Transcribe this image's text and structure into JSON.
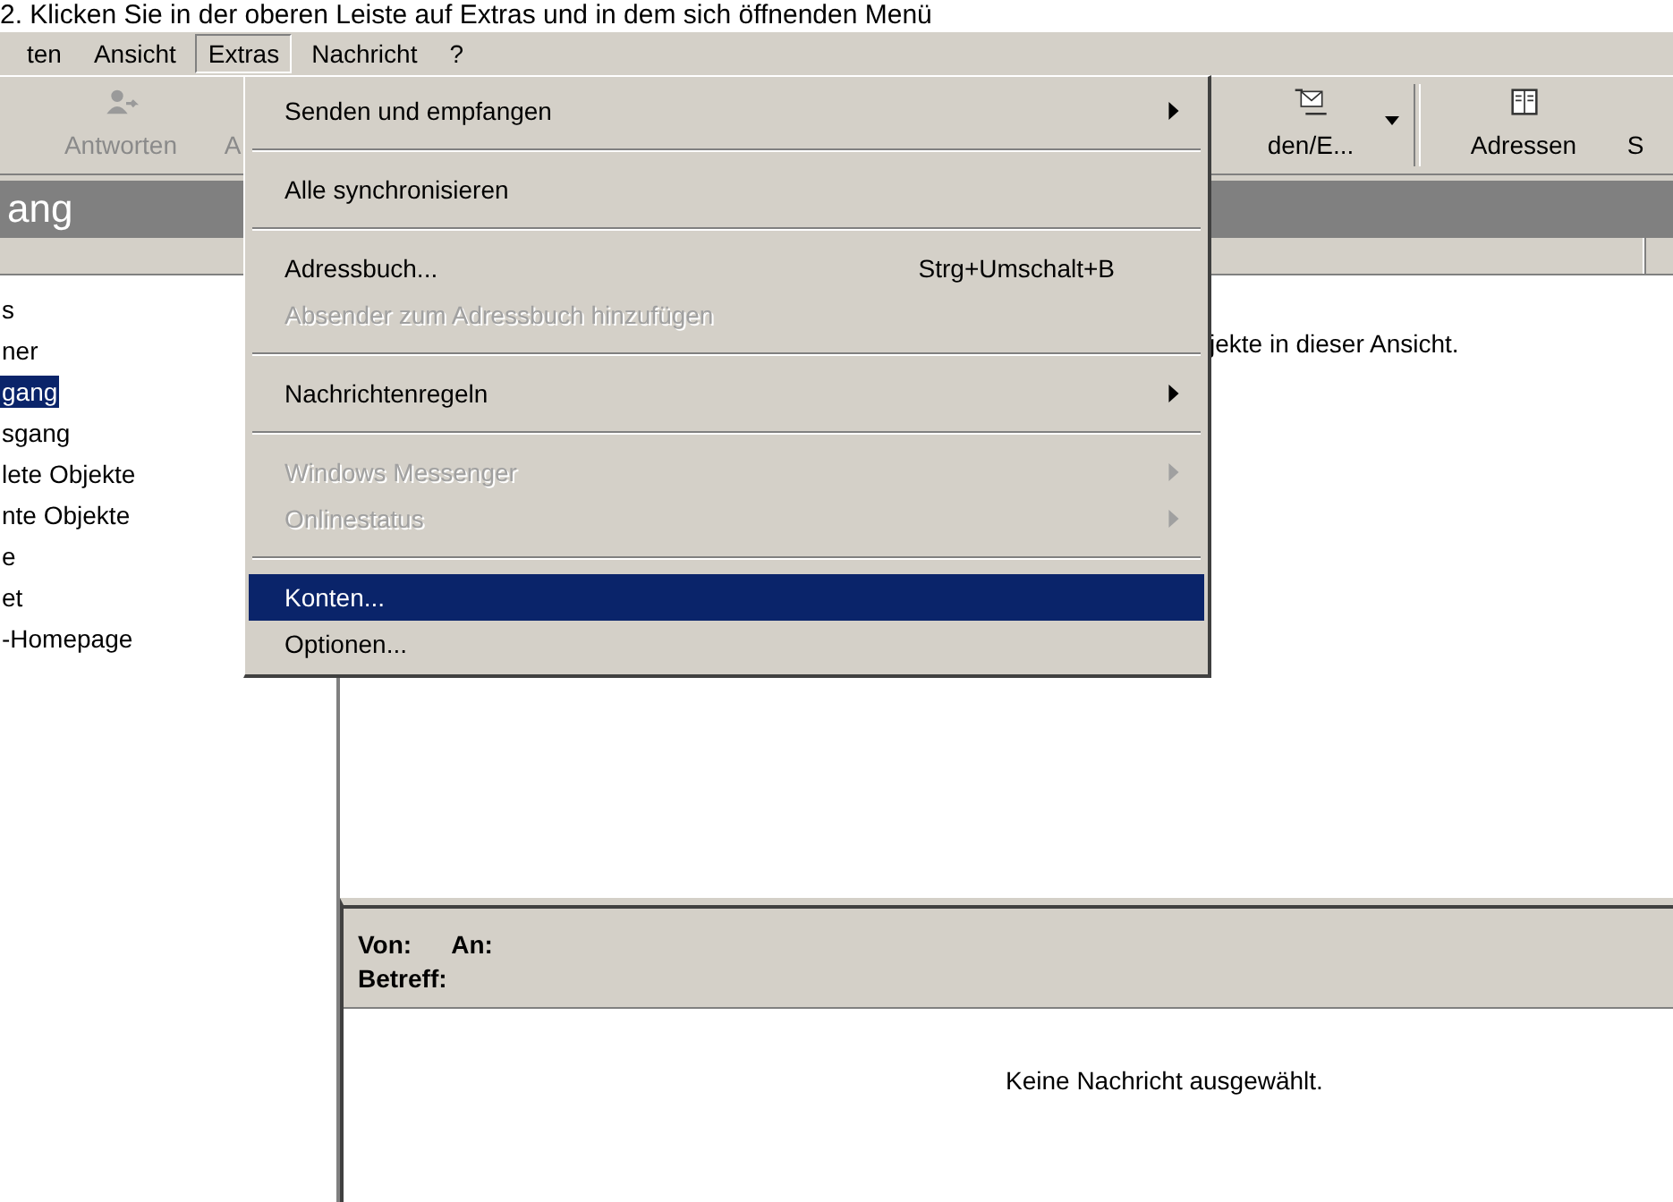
{
  "caption": "2. Klicken Sie in der oberen Leiste auf Extras und in dem sich öffnenden Menü",
  "menubar": [
    {
      "label": "ten",
      "selected": false
    },
    {
      "label": "Ansicht",
      "selected": false
    },
    {
      "label": "Extras",
      "selected": true
    },
    {
      "label": "Nachricht",
      "selected": false
    },
    {
      "label": "?",
      "selected": false
    }
  ],
  "toolbar": [
    {
      "label": "Antworten",
      "disabled": true
    },
    {
      "label": "A",
      "disabled": true
    },
    {
      "label": "den/E...",
      "disabled": false,
      "dropdown": true
    },
    {
      "label": "Adressen",
      "disabled": false
    },
    {
      "label": "S",
      "disabled": false
    }
  ],
  "folder_title": "ang",
  "folders": [
    {
      "label": "s",
      "selected": false
    },
    {
      "label": "ner",
      "selected": false
    },
    {
      "label": "gang",
      "selected": true
    },
    {
      "label": "sgang",
      "selected": false
    },
    {
      "label": "lete Objekte",
      "selected": false
    },
    {
      "label": "nte Objekte",
      "selected": false
    },
    {
      "label": "e",
      "selected": false
    },
    {
      "label": "et",
      "selected": false
    },
    {
      "label": "-Homepage",
      "selected": false
    }
  ],
  "list_message": "jekte in dieser Ansicht.",
  "preview": {
    "from_label": "Von:",
    "to_label": "An:",
    "subject_label": "Betreff:",
    "body": "Keine Nachricht ausgewählt."
  },
  "menu": [
    {
      "kind": "item",
      "label": "Senden und empfangen",
      "submenu": true,
      "disabled": false,
      "selected": false
    },
    {
      "kind": "separator"
    },
    {
      "kind": "item",
      "label": "Alle synchronisieren",
      "disabled": false,
      "selected": false
    },
    {
      "kind": "separator"
    },
    {
      "kind": "item",
      "label": "Adressbuch...",
      "shortcut": "Strg+Umschalt+B",
      "disabled": false,
      "selected": false
    },
    {
      "kind": "item",
      "label": "Absender zum Adressbuch hinzufügen",
      "disabled": true,
      "selected": false
    },
    {
      "kind": "separator"
    },
    {
      "kind": "item",
      "label": "Nachrichtenregeln",
      "submenu": true,
      "disabled": false,
      "selected": false
    },
    {
      "kind": "separator"
    },
    {
      "kind": "item",
      "label": "Windows Messenger",
      "submenu": true,
      "disabled": true,
      "selected": false
    },
    {
      "kind": "item",
      "label": "Onlinestatus",
      "submenu": true,
      "disabled": true,
      "selected": false
    },
    {
      "kind": "separator"
    },
    {
      "kind": "item",
      "label": "Konten...",
      "disabled": false,
      "selected": true
    },
    {
      "kind": "item",
      "label": "Optionen...",
      "disabled": false,
      "selected": false
    }
  ]
}
